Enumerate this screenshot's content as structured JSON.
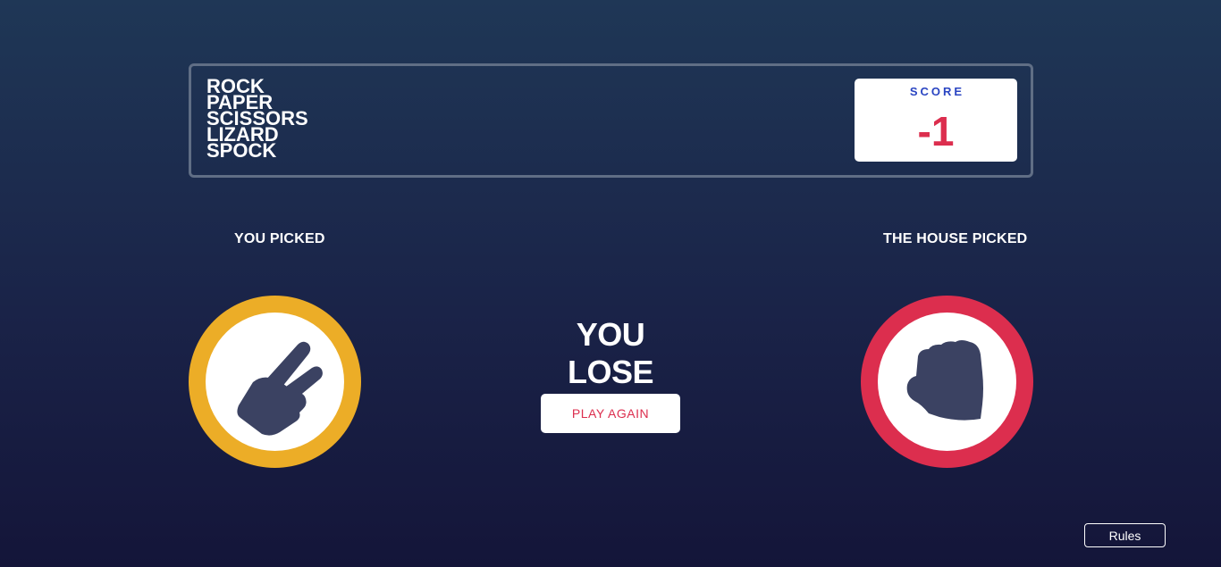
{
  "header": {
    "title_lines": [
      "ROCK",
      "PAPER",
      "SCISSORS",
      "LIZARD",
      "SPOCK"
    ],
    "score_label": "SCORE",
    "score_value": "-1"
  },
  "you": {
    "label": "YOU PICKED",
    "choice_icon": "scissors-icon",
    "ring_color": "#ecad27"
  },
  "house": {
    "label": "THE HOUSE PICKED",
    "choice_icon": "rock-icon",
    "ring_color": "#dc2e4e"
  },
  "result": {
    "text": "YOU LOSE",
    "play_again_label": "PLAY AGAIN"
  },
  "rules_label": "Rules",
  "colors": {
    "score_label": "#2a45c2",
    "score_value": "#dc2e4e",
    "icon": "#3b4262"
  }
}
